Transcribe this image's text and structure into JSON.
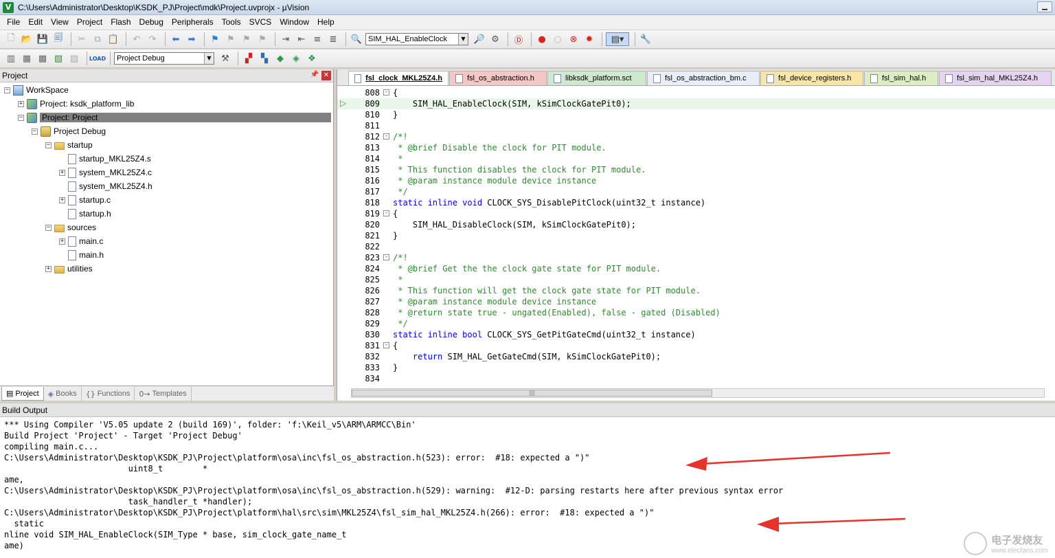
{
  "window": {
    "title": "C:\\Users\\Administrator\\Desktop\\KSDK_PJ\\Project\\mdk\\Project.uvprojx - µVision",
    "app_icon": "V"
  },
  "menu": [
    "File",
    "Edit",
    "View",
    "Project",
    "Flash",
    "Debug",
    "Peripherals",
    "Tools",
    "SVCS",
    "Window",
    "Help"
  ],
  "toolbar1": {
    "function_combo": "SIM_HAL_EnableClock"
  },
  "toolbar2": {
    "target_combo": "Project Debug",
    "load_label": "LOAD"
  },
  "project_panel": {
    "title": "Project",
    "tree": [
      {
        "label": "WorkSpace",
        "icon": "workspace-icon"
      },
      {
        "label": "Project: ksdk_platform_lib",
        "icon": "project-icon"
      },
      {
        "label": "Project: Project",
        "icon": "project-icon"
      },
      {
        "label": "Project Debug",
        "icon": "target-icon"
      },
      {
        "label": "startup",
        "icon": "folder-icon"
      },
      {
        "label": "startup_MKL25Z4.s",
        "icon": "file-icon"
      },
      {
        "label": "system_MKL25Z4.c",
        "icon": "file-icon"
      },
      {
        "label": "system_MKL25Z4.h",
        "icon": "file-icon"
      },
      {
        "label": "startup.c",
        "icon": "file-icon"
      },
      {
        "label": "startup.h",
        "icon": "file-icon"
      },
      {
        "label": "sources",
        "icon": "folder-icon"
      },
      {
        "label": "main.c",
        "icon": "file-icon"
      },
      {
        "label": "main.h",
        "icon": "file-icon"
      },
      {
        "label": "utilities",
        "icon": "folder-icon"
      }
    ],
    "tabs": [
      {
        "label": "Project"
      },
      {
        "label": "Books"
      },
      {
        "label": "Functions"
      },
      {
        "label": "Templates"
      }
    ]
  },
  "editor": {
    "tabs": [
      {
        "label": "fsl_clock_MKL25Z4.h",
        "color": "#ffffff"
      },
      {
        "label": "fsl_os_abstraction.h",
        "color": "#f4c7c7"
      },
      {
        "label": "libksdk_platform.sct",
        "color": "#cfe9cf"
      },
      {
        "label": "fsl_os_abstraction_bm.c",
        "color": "#e9eef6"
      },
      {
        "label": "fsl_device_registers.h",
        "color": "#f7e6a6"
      },
      {
        "label": "fsl_sim_hal.h",
        "color": "#dcedc6"
      },
      {
        "label": "fsl_sim_hal_MKL25Z4.h",
        "color": "#e4d4ef"
      }
    ],
    "lines": [
      {
        "n": "808",
        "text": "{",
        "kind": "plain",
        "fold": "-"
      },
      {
        "n": "809",
        "text": "    SIM_HAL_EnableClock(SIM, kSimClockGatePit0);",
        "kind": "plain",
        "current": true
      },
      {
        "n": "810",
        "text": "}",
        "kind": "plain"
      },
      {
        "n": "811",
        "text": "",
        "kind": "plain"
      },
      {
        "n": "812",
        "text": "/*!",
        "kind": "comment",
        "fold": "-"
      },
      {
        "n": "813",
        "text": " * @brief Disable the clock for PIT module.",
        "kind": "comment"
      },
      {
        "n": "814",
        "text": " *",
        "kind": "comment"
      },
      {
        "n": "815",
        "text": " * This function disables the clock for PIT module.",
        "kind": "comment"
      },
      {
        "n": "816",
        "text": " * @param instance module device instance",
        "kind": "comment"
      },
      {
        "n": "817",
        "text": " */",
        "kind": "comment"
      },
      {
        "n": "818",
        "kw": "static inline void",
        "text": " CLOCK_SYS_DisablePitClock(uint32_t instance)",
        "kind": "decl"
      },
      {
        "n": "819",
        "text": "{",
        "kind": "plain",
        "fold": "-"
      },
      {
        "n": "820",
        "text": "    SIM_HAL_DisableClock(SIM, kSimClockGatePit0);",
        "kind": "plain"
      },
      {
        "n": "821",
        "text": "}",
        "kind": "plain"
      },
      {
        "n": "822",
        "text": "",
        "kind": "plain"
      },
      {
        "n": "823",
        "text": "/*!",
        "kind": "comment",
        "fold": "-"
      },
      {
        "n": "824",
        "text": " * @brief Get the the clock gate state for PIT module.",
        "kind": "comment"
      },
      {
        "n": "825",
        "text": " *",
        "kind": "comment"
      },
      {
        "n": "826",
        "text": " * This function will get the clock gate state for PIT module.",
        "kind": "comment"
      },
      {
        "n": "827",
        "text": " * @param instance module device instance",
        "kind": "comment"
      },
      {
        "n": "828",
        "text": " * @return state true - ungated(Enabled), false - gated (Disabled)",
        "kind": "comment"
      },
      {
        "n": "829",
        "text": " */",
        "kind": "comment"
      },
      {
        "n": "830",
        "kw": "static inline bool",
        "text": " CLOCK_SYS_GetPitGateCmd(uint32_t instance)",
        "kind": "decl"
      },
      {
        "n": "831",
        "text": "{",
        "kind": "plain",
        "fold": "-"
      },
      {
        "n": "832",
        "kw": "    return",
        "text": " SIM_HAL_GetGateCmd(SIM, kSimClockGatePit0);",
        "kind": "decl"
      },
      {
        "n": "833",
        "text": "}",
        "kind": "plain"
      },
      {
        "n": "834",
        "text": "",
        "kind": "plain"
      }
    ]
  },
  "build_output": {
    "title": "Build Output",
    "lines": [
      "*** Using Compiler 'V5.05 update 2 (build 169)', folder: 'f:\\Keil_v5\\ARM\\ARMCC\\Bin'",
      "Build Project 'Project' - Target 'Project Debug'",
      "compiling main.c...",
      "C:\\Users\\Administrator\\Desktop\\KSDK_PJ\\Project\\platform\\osa\\inc\\fsl_os_abstraction.h(523): error:  #18: expected a \")\"",
      "                         uint8_t        *",
      "ame,",
      "C:\\Users\\Administrator\\Desktop\\KSDK_PJ\\Project\\platform\\osa\\inc\\fsl_os_abstraction.h(529): warning:  #12-D: parsing restarts here after previous syntax error",
      "                         task_handler_t *handler);",
      "C:\\Users\\Administrator\\Desktop\\KSDK_PJ\\Project\\platform\\hal\\src\\sim\\MKL25Z4\\fsl_sim_hal_MKL25Z4.h(266): error:  #18: expected a \")\"",
      "  static",
      "nline void SIM_HAL_EnableClock(SIM_Type * base, sim_clock_gate_name_t",
      "ame)"
    ],
    "annotation_color": "#e8322c"
  },
  "watermark": {
    "title": "电子发烧友",
    "url": "www.elecfans.com"
  }
}
